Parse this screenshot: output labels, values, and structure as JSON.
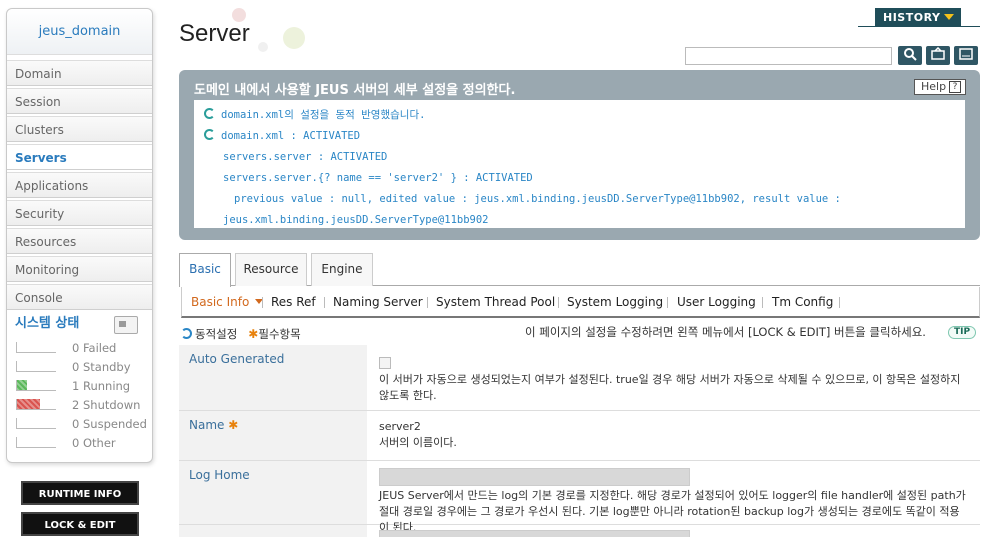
{
  "sidebar": {
    "domain_name": "jeus_domain",
    "menu": [
      {
        "label": "Domain"
      },
      {
        "label": "Session"
      },
      {
        "label": "Clusters"
      },
      {
        "label": "Servers"
      },
      {
        "label": "Applications"
      },
      {
        "label": "Security"
      },
      {
        "label": "Resources"
      },
      {
        "label": "Monitoring"
      },
      {
        "label": "Console"
      }
    ],
    "active_item": "Servers",
    "system_status": {
      "title": "시스템 상태",
      "items": [
        {
          "count": "0",
          "label": "Failed",
          "fill": 0,
          "color": "#ffffff"
        },
        {
          "count": "0",
          "label": "Standby",
          "fill": 0,
          "color": "#ffffff"
        },
        {
          "count": "1",
          "label": "Running",
          "fill": 0.25,
          "color": "#5cb85c"
        },
        {
          "count": "2",
          "label": "Shutdown",
          "fill": 0.6,
          "color": "#d9534f"
        },
        {
          "count": "0",
          "label": "Suspended",
          "fill": 0,
          "color": "#ffffff"
        },
        {
          "count": "0",
          "label": "Other",
          "fill": 0,
          "color": "#ffffff"
        }
      ]
    },
    "runtime_info_label": "RUNTIME INFO",
    "lock_edit_label": "LOCK & EDIT"
  },
  "header": {
    "title": "Server",
    "history_label": "HISTORY",
    "search": {
      "value": "",
      "placeholder": ""
    }
  },
  "info_panel": {
    "title": "도메인 내에서 사용할 JEUS 서버의 세부 설정을 정의한다.",
    "help_label": "Help",
    "lines": [
      "domain.xml의 설정을 동적 반영했습니다.",
      "domain.xml : ACTIVATED",
      "servers.server : ACTIVATED",
      "servers.server.{? name == 'server2' } : ACTIVATED",
      "previous value : null, edited value : jeus.xml.binding.jeusDD.ServerType@11bb902, result value :",
      "jeus.xml.binding.jeusDD.ServerType@11bb902"
    ]
  },
  "tabs": [
    "Basic",
    "Resource",
    "Engine"
  ],
  "subtabs": [
    "Basic Info",
    "Res Ref",
    "Naming Server",
    "System Thread Pool",
    "System Logging",
    "User Logging",
    "Tm Config"
  ],
  "legend": {
    "dynamic": "동적설정",
    "required": "필수항목",
    "notice": "이 페이지의 설정을 수정하려면 왼쪽 메뉴에서 [LOCK & EDIT] 버튼을 클릭하세요.",
    "tip": "TIP"
  },
  "fields": {
    "auto_generated": {
      "label": "Auto Generated",
      "desc": "이 서버가 자동으로 생성되었는지 여부가 설정된다. true일 경우 해당 서버가 자동으로 삭제될 수 있으므로, 이 항목은 설정하지 않도록 한다."
    },
    "name": {
      "label": "Name",
      "value": "server2",
      "desc": "서버의 이름이다."
    },
    "log_home": {
      "label": "Log Home",
      "value": "",
      "desc": "JEUS Server에서 만드는 log의 기본 경로를 지정한다. 해당 경로가 설정되어 있어도 logger의 file handler에 설정된 path가 절대 경로일 경우에는 그 경로가 우선시 된다. 기본 log뿐만 아니라 rotation된 backup log가 생성되는 경로에도 똑같이 적용이 된다."
    }
  }
}
